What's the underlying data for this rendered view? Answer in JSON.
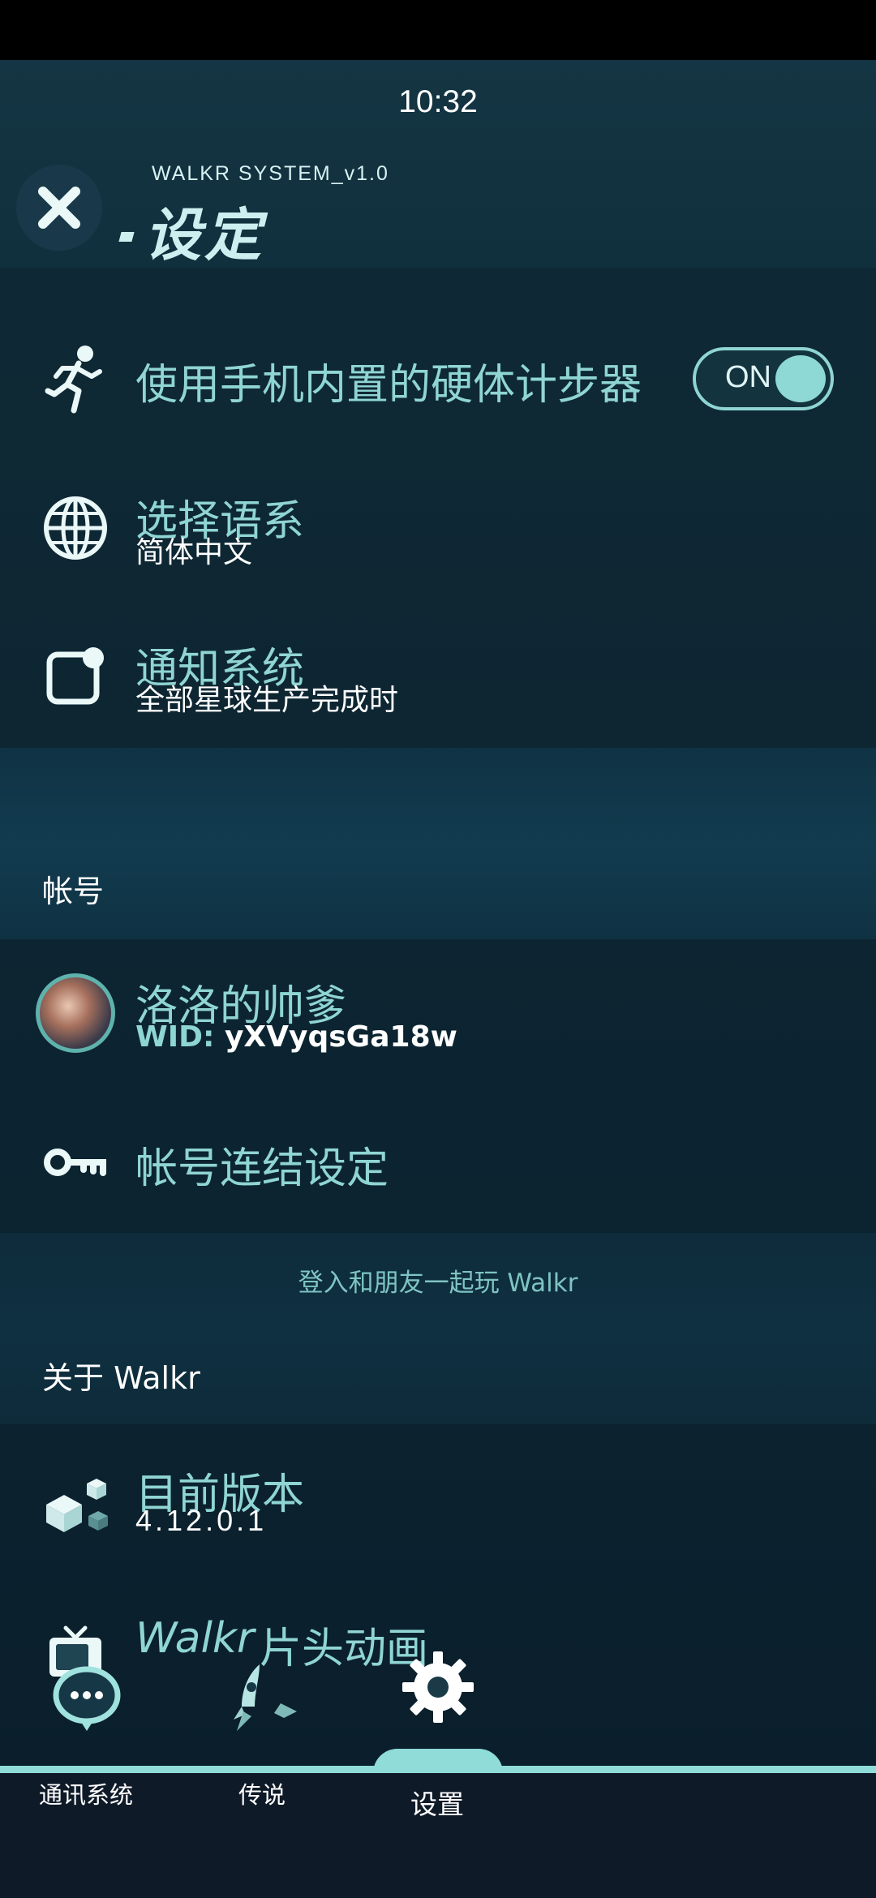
{
  "status_bar": {
    "time": "10:32"
  },
  "header": {
    "system_label": "WALKR SYSTEM_v1.0",
    "title": "设定",
    "close_icon": "close-icon"
  },
  "settings": {
    "pedometer": {
      "label": "使用手机内置的硬体计步器",
      "toggle_text": "ON",
      "toggle_on": true,
      "icon": "running-man-icon"
    },
    "language": {
      "label": "选择语系",
      "value": "简体中文",
      "icon": "globe-icon"
    },
    "notification": {
      "label": "通知系统",
      "value": "全部星球生产完成时",
      "icon": "notification-icon"
    }
  },
  "account": {
    "section_label": "帐号",
    "user_name": "洛洛的帅爹",
    "wid_prefix": "WID:",
    "wid_value": "yXVyqsGa18w",
    "link_label": "帐号连结设定",
    "link_icon": "key-icon",
    "hint": "登入和朋友一起玩 Walkr"
  },
  "about": {
    "section_label": "关于 Walkr",
    "version_label": "目前版本",
    "version_value": "4.12.0.1",
    "version_icon": "cubes-icon",
    "intro_brand": "Walkr",
    "intro_label": "片头动画",
    "intro_icon": "tv-icon"
  },
  "bottom_nav": {
    "items": [
      {
        "label": "通讯系统",
        "icon": "chat-bubble-icon"
      },
      {
        "label": "传说",
        "icon": "rocket-icon"
      },
      {
        "label": "设置",
        "icon": "gear-icon",
        "active": true
      }
    ]
  },
  "colors": {
    "accent": "#8fd5d3",
    "background": "#0d2632",
    "nav": "#0f1a28"
  }
}
